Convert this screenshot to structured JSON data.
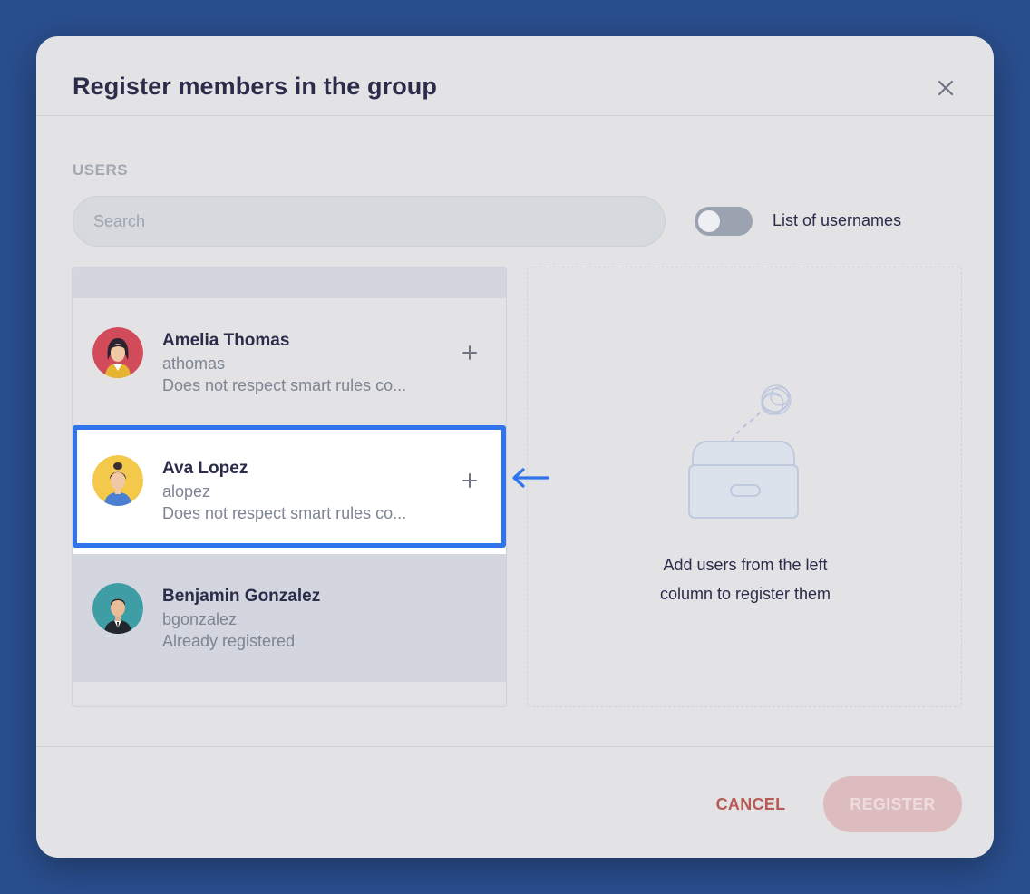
{
  "dialog": {
    "title": "Register members in the group"
  },
  "users_section": {
    "label": "USERS",
    "search_placeholder": "Search",
    "toggle_label": "List of usernames",
    "toggle_on": false
  },
  "users": [
    {
      "name": "Amelia Thomas",
      "username": "athomas",
      "status": "Does not respect smart rules co...",
      "can_add": true,
      "avatar_color": "#d14b5a"
    },
    {
      "name": "Ava Lopez",
      "username": "alopez",
      "status": "Does not respect smart rules co...",
      "can_add": true,
      "avatar_color": "#f4c84a"
    },
    {
      "name": "Benjamin Gonzalez",
      "username": "bgonzalez",
      "status": "Already registered",
      "can_add": false,
      "avatar_color": "#3e9da5"
    }
  ],
  "dropzone": {
    "text_line1": "Add users from the left",
    "text_line2": "column to register them"
  },
  "footer": {
    "cancel_label": "CANCEL",
    "register_label": "REGISTER"
  },
  "colors": {
    "highlight": "#2f74ea",
    "cancel": "#b85a56",
    "register_disabled_bg": "#ddbcbf"
  }
}
